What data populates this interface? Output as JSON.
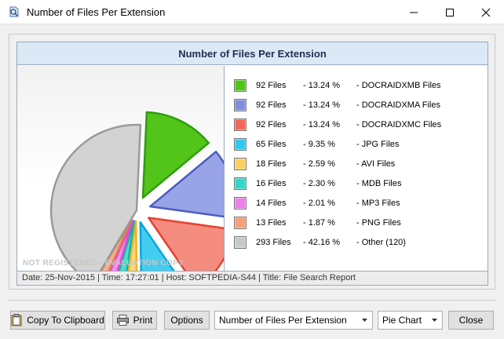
{
  "window": {
    "title": "Number of Files Per Extension",
    "icon": "app-icon"
  },
  "report": {
    "title": "Number of Files Per Extension",
    "watermark": "NOT REGISTERED - EVALUATION COPY",
    "status": "Date: 25-Nov-2015 | Time: 17:27:01 | Host: SOFTPEDIA-S44 | Title: File Search Report"
  },
  "legend": [
    {
      "files": "92 Files",
      "pct": "-  13.24 %",
      "name": "-  DOCRAIDXMB Files",
      "color": "#52c41a"
    },
    {
      "files": "92 Files",
      "pct": "-  13.24 %",
      "name": "-  DOCRAIDXMA Files",
      "color": "#7f8fdc"
    },
    {
      "files": "92 Files",
      "pct": "-  13.24 %",
      "name": "-  DOCRAIDXMC Files",
      "color": "#f2675c"
    },
    {
      "files": "65 Files",
      "pct": "-  9.35 %",
      "name": "-  JPG Files",
      "color": "#33c7ee"
    },
    {
      "files": "18 Files",
      "pct": "-  2.59 %",
      "name": "-  AVI Files",
      "color": "#fccf62"
    },
    {
      "files": "16 Files",
      "pct": "-  2.30 %",
      "name": "-  MDB Files",
      "color": "#2fd8c7"
    },
    {
      "files": "14 Files",
      "pct": "-  2.01 %",
      "name": "-  MP3 Files",
      "color": "#ee7ee8"
    },
    {
      "files": "13 Files",
      "pct": "-  1.87 %",
      "name": "-  PNG Files",
      "color": "#f4a07a"
    },
    {
      "files": "293 Files",
      "pct": "-  42.16 %",
      "name": "-  Other (120)",
      "color": "#c8c8c8"
    }
  ],
  "chart_data": {
    "type": "pie",
    "title": "Number of Files Per Extension",
    "slices": [
      {
        "label": "DOCRAIDXMB Files",
        "count": 92,
        "percent": 13.24,
        "color": "#52c41a",
        "edge": "#2e9e10"
      },
      {
        "label": "DOCRAIDXMA Files",
        "count": 92,
        "percent": 13.24,
        "color": "#98a4e6",
        "edge": "#4b5bc4"
      },
      {
        "label": "DOCRAIDXMC Files",
        "count": 92,
        "percent": 13.24,
        "color": "#f58c80",
        "edge": "#e8412f"
      },
      {
        "label": "JPG Files",
        "count": 65,
        "percent": 9.35,
        "color": "#43cdf0",
        "edge": "#0aa6d9"
      },
      {
        "label": "AVI Files",
        "count": 18,
        "percent": 2.59,
        "color": "#fdd77a",
        "edge": "#f0b020"
      },
      {
        "label": "MDB Files",
        "count": 16,
        "percent": 2.3,
        "color": "#4fdecf",
        "edge": "#12b5a4"
      },
      {
        "label": "MP3 Files",
        "count": 14,
        "percent": 2.01,
        "color": "#f190ec",
        "edge": "#d84fd0"
      },
      {
        "label": "PNG Files",
        "count": 13,
        "percent": 1.87,
        "color": "#f6b092",
        "edge": "#e27b4e"
      },
      {
        "label": "Other (120)",
        "count": 293,
        "percent": 42.16,
        "color": "#d3d3d3",
        "edge": "#9a9a9a"
      }
    ]
  },
  "buttons": {
    "copy": "Copy To Clipboard",
    "print": "Print",
    "options": "Options",
    "close": "Close"
  },
  "report_select": {
    "value": "Number of Files Per Extension"
  },
  "chart_select": {
    "value": "Pie Chart"
  }
}
